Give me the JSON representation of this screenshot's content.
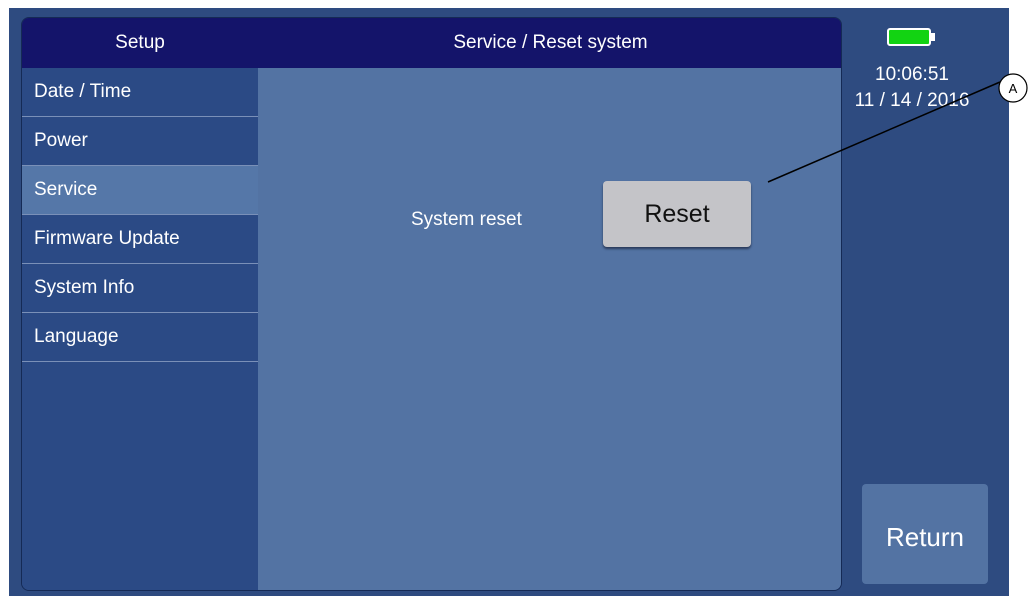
{
  "header": {
    "section": "Setup",
    "title": "Service / Reset system"
  },
  "sidebar": {
    "items": [
      {
        "label": "Date / Time",
        "active": false
      },
      {
        "label": "Power",
        "active": false
      },
      {
        "label": "Service",
        "active": true
      },
      {
        "label": "Firmware Update",
        "active": false
      },
      {
        "label": "System Info",
        "active": false
      },
      {
        "label": "Language",
        "active": false
      }
    ]
  },
  "main": {
    "system_reset_label": "System reset",
    "reset_button": "Reset"
  },
  "status": {
    "time": "10:06:51",
    "date": "11 / 14 / 2016",
    "battery_color": "#12d312"
  },
  "return_button": "Return",
  "callout": {
    "label": "A"
  },
  "colors": {
    "header_bg": "#14146a",
    "panel_bg": "#2b4a85",
    "content_bg": "#5373a3",
    "active_item_bg": "#5577a8"
  }
}
